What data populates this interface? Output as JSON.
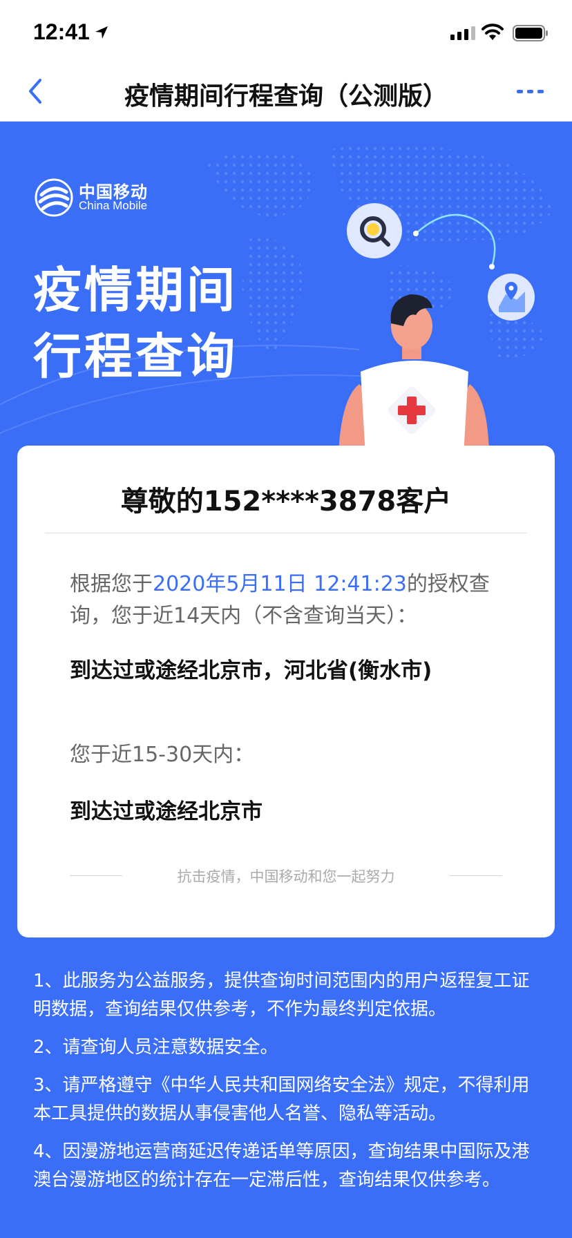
{
  "status_bar": {
    "time": "12:41"
  },
  "nav": {
    "title": "疫情期间行程查询（公测版）"
  },
  "hero": {
    "brand_cn": "中国移动",
    "brand_en": "China Mobile",
    "title_line1": "疫情期间",
    "title_line2": "行程查询"
  },
  "card": {
    "greeting": "尊敬的152****3878客户",
    "query_prefix": "根据您于",
    "query_time": "2020年5月11日 12:41:23",
    "query_suffix": "的授权查询，您于近14天内（不含查询当天）：",
    "result_14": "到达过或途经北京市，河北省(衡水市)",
    "period_30": "您于近15-30天内：",
    "result_30": "到达过或途经北京市",
    "slogan": "抗击疫情，中国移动和您一起努力"
  },
  "notes": [
    "1、此服务为公益服务，提供查询时间范围内的用户返程复工证明数据，查询结果仅供参考，不作为最终判定依据。",
    "2、请查询人员注意数据安全。",
    "3、请严格遵守《中华人民共和国网络安全法》规定，不得利用本工具提供的数据从事侵害他人名誉、隐私等活动。",
    "4、因漫游地运营商延迟传递话单等原因，查询结果中国际及港澳台漫游地区的统计存在一定滞后性，查询结果仅供参考。"
  ],
  "colors": {
    "brand_blue": "#3a6ef6",
    "card_bg": "#ffffff",
    "link_blue": "#3a6ef6"
  }
}
